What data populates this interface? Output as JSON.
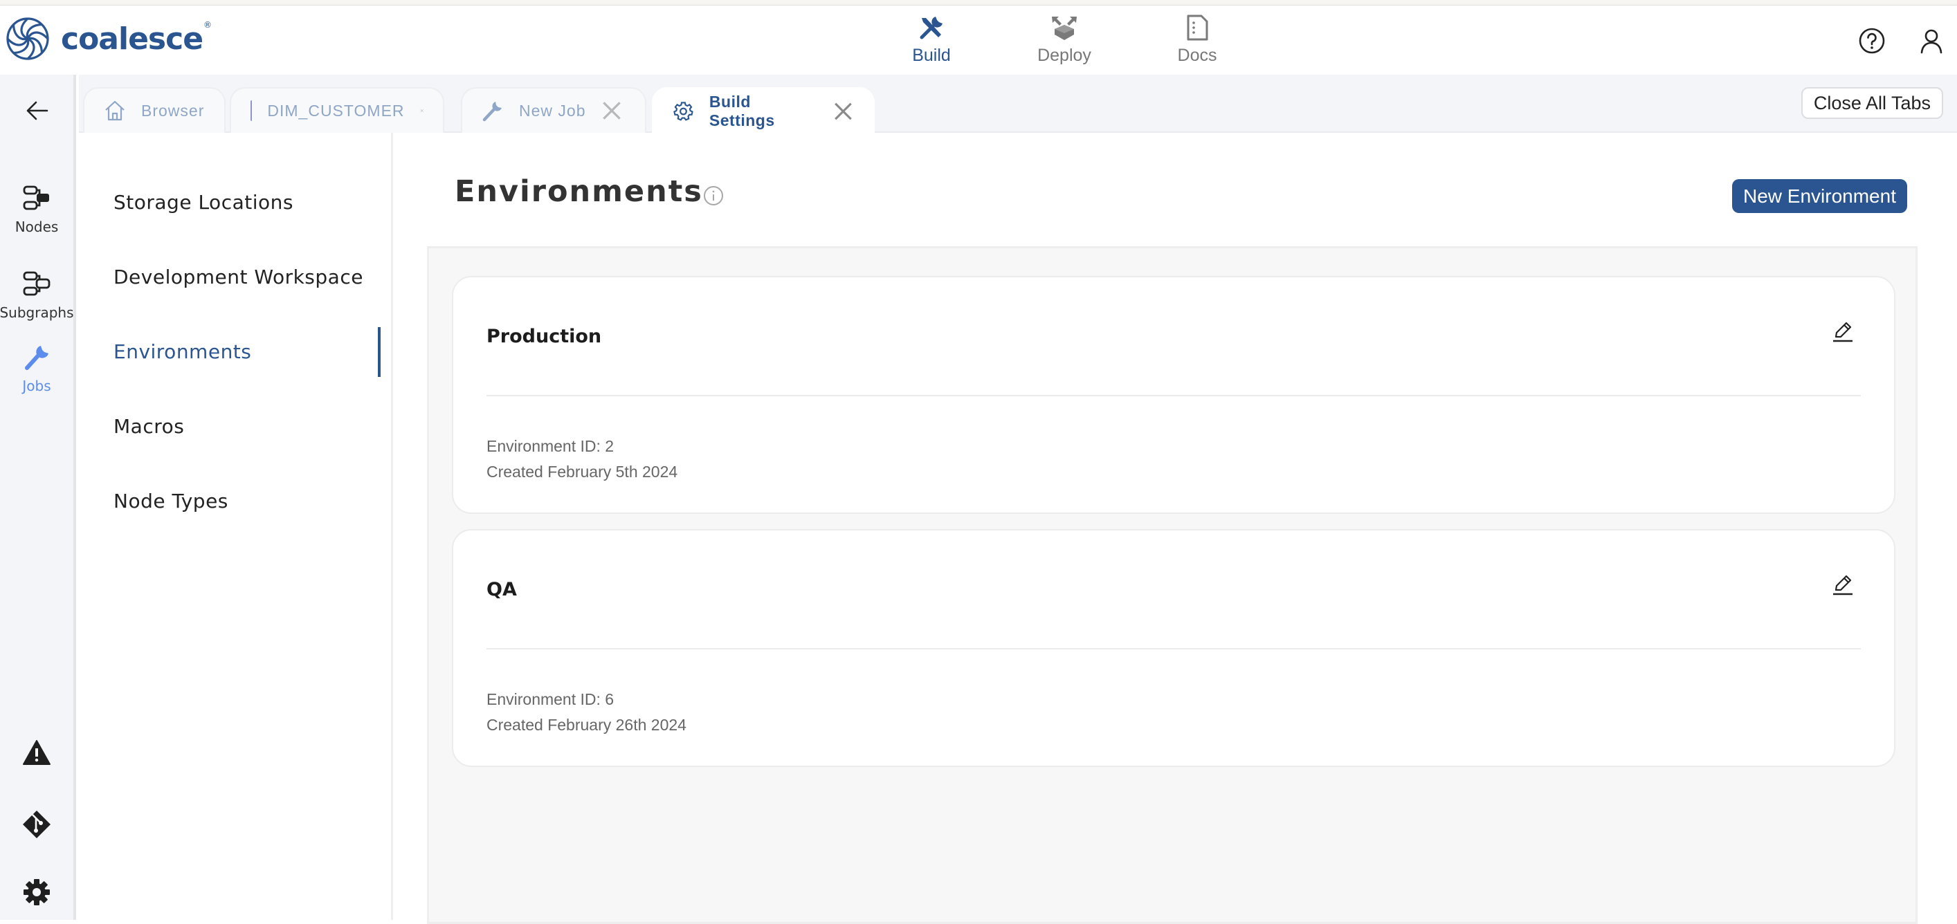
{
  "brand": {
    "name": "coalesce",
    "mark": "®",
    "color": "#2a5590"
  },
  "topnav": [
    {
      "label": "Build",
      "icon": "build-tools-icon",
      "active": true
    },
    {
      "label": "Deploy",
      "icon": "deploy-box-icon",
      "active": false
    },
    {
      "label": "Docs",
      "icon": "docs-file-icon",
      "active": false
    }
  ],
  "header_icons": [
    "help-icon",
    "user-icon"
  ],
  "rail": {
    "items": [
      {
        "label": "Nodes",
        "icon": "nodes-icon",
        "active": false
      },
      {
        "label": "Subgraphs",
        "icon": "subgraphs-icon",
        "active": false
      },
      {
        "label": "Jobs",
        "icon": "wrench-icon",
        "active": true
      }
    ],
    "bottom_icons": [
      "warning-icon",
      "git-icon",
      "settings-gear-icon"
    ]
  },
  "tabs": [
    {
      "label": "Browser",
      "icon": "home-icon",
      "closable": false,
      "active": false
    },
    {
      "label": "DIM_CUSTOMER",
      "icon": "node-color-chip-icon",
      "closable": true,
      "active": false
    },
    {
      "label": "New Job",
      "icon": "wrench-icon",
      "closable": true,
      "active": false
    },
    {
      "label": "Build Settings",
      "icon": "gear-icon",
      "closable": true,
      "active": true
    }
  ],
  "close_all_label": "Close All Tabs",
  "settings_nav": [
    {
      "label": "Storage Locations",
      "active": false
    },
    {
      "label": "Development Workspace",
      "active": false
    },
    {
      "label": "Environments",
      "active": true
    },
    {
      "label": "Macros",
      "active": false
    },
    {
      "label": "Node Types",
      "active": false
    }
  ],
  "page": {
    "title": "Environments",
    "new_button_label": "New Environment"
  },
  "environments": [
    {
      "name": "Production",
      "id_line": "Environment ID: 2",
      "created_line": "Created February 5th 2024"
    },
    {
      "name": "QA",
      "id_line": "Environment ID: 6",
      "created_line": "Created February 26th 2024"
    }
  ],
  "colors": {
    "accent": "#2a5590",
    "rail_active": "#5c8ded",
    "tab_inactive_text": "#8fa6c6",
    "node_chip": "#8f94c8"
  }
}
